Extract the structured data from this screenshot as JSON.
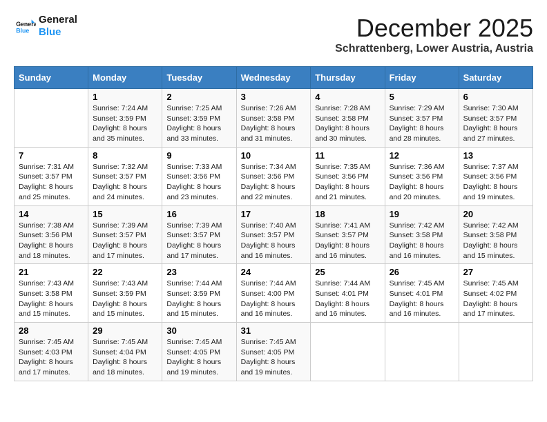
{
  "logo": {
    "line1": "General",
    "line2": "Blue"
  },
  "title": "December 2025",
  "location": "Schrattenberg, Lower Austria, Austria",
  "days_of_week": [
    "Sunday",
    "Monday",
    "Tuesday",
    "Wednesday",
    "Thursday",
    "Friday",
    "Saturday"
  ],
  "weeks": [
    [
      {
        "day": "",
        "info": ""
      },
      {
        "day": "1",
        "info": "Sunrise: 7:24 AM\nSunset: 3:59 PM\nDaylight: 8 hours\nand 35 minutes."
      },
      {
        "day": "2",
        "info": "Sunrise: 7:25 AM\nSunset: 3:59 PM\nDaylight: 8 hours\nand 33 minutes."
      },
      {
        "day": "3",
        "info": "Sunrise: 7:26 AM\nSunset: 3:58 PM\nDaylight: 8 hours\nand 31 minutes."
      },
      {
        "day": "4",
        "info": "Sunrise: 7:28 AM\nSunset: 3:58 PM\nDaylight: 8 hours\nand 30 minutes."
      },
      {
        "day": "5",
        "info": "Sunrise: 7:29 AM\nSunset: 3:57 PM\nDaylight: 8 hours\nand 28 minutes."
      },
      {
        "day": "6",
        "info": "Sunrise: 7:30 AM\nSunset: 3:57 PM\nDaylight: 8 hours\nand 27 minutes."
      }
    ],
    [
      {
        "day": "7",
        "info": "Sunrise: 7:31 AM\nSunset: 3:57 PM\nDaylight: 8 hours\nand 25 minutes."
      },
      {
        "day": "8",
        "info": "Sunrise: 7:32 AM\nSunset: 3:57 PM\nDaylight: 8 hours\nand 24 minutes."
      },
      {
        "day": "9",
        "info": "Sunrise: 7:33 AM\nSunset: 3:56 PM\nDaylight: 8 hours\nand 23 minutes."
      },
      {
        "day": "10",
        "info": "Sunrise: 7:34 AM\nSunset: 3:56 PM\nDaylight: 8 hours\nand 22 minutes."
      },
      {
        "day": "11",
        "info": "Sunrise: 7:35 AM\nSunset: 3:56 PM\nDaylight: 8 hours\nand 21 minutes."
      },
      {
        "day": "12",
        "info": "Sunrise: 7:36 AM\nSunset: 3:56 PM\nDaylight: 8 hours\nand 20 minutes."
      },
      {
        "day": "13",
        "info": "Sunrise: 7:37 AM\nSunset: 3:56 PM\nDaylight: 8 hours\nand 19 minutes."
      }
    ],
    [
      {
        "day": "14",
        "info": "Sunrise: 7:38 AM\nSunset: 3:56 PM\nDaylight: 8 hours\nand 18 minutes."
      },
      {
        "day": "15",
        "info": "Sunrise: 7:39 AM\nSunset: 3:57 PM\nDaylight: 8 hours\nand 17 minutes."
      },
      {
        "day": "16",
        "info": "Sunrise: 7:39 AM\nSunset: 3:57 PM\nDaylight: 8 hours\nand 17 minutes."
      },
      {
        "day": "17",
        "info": "Sunrise: 7:40 AM\nSunset: 3:57 PM\nDaylight: 8 hours\nand 16 minutes."
      },
      {
        "day": "18",
        "info": "Sunrise: 7:41 AM\nSunset: 3:57 PM\nDaylight: 8 hours\nand 16 minutes."
      },
      {
        "day": "19",
        "info": "Sunrise: 7:42 AM\nSunset: 3:58 PM\nDaylight: 8 hours\nand 16 minutes."
      },
      {
        "day": "20",
        "info": "Sunrise: 7:42 AM\nSunset: 3:58 PM\nDaylight: 8 hours\nand 15 minutes."
      }
    ],
    [
      {
        "day": "21",
        "info": "Sunrise: 7:43 AM\nSunset: 3:58 PM\nDaylight: 8 hours\nand 15 minutes."
      },
      {
        "day": "22",
        "info": "Sunrise: 7:43 AM\nSunset: 3:59 PM\nDaylight: 8 hours\nand 15 minutes."
      },
      {
        "day": "23",
        "info": "Sunrise: 7:44 AM\nSunset: 3:59 PM\nDaylight: 8 hours\nand 15 minutes."
      },
      {
        "day": "24",
        "info": "Sunrise: 7:44 AM\nSunset: 4:00 PM\nDaylight: 8 hours\nand 16 minutes."
      },
      {
        "day": "25",
        "info": "Sunrise: 7:44 AM\nSunset: 4:01 PM\nDaylight: 8 hours\nand 16 minutes."
      },
      {
        "day": "26",
        "info": "Sunrise: 7:45 AM\nSunset: 4:01 PM\nDaylight: 8 hours\nand 16 minutes."
      },
      {
        "day": "27",
        "info": "Sunrise: 7:45 AM\nSunset: 4:02 PM\nDaylight: 8 hours\nand 17 minutes."
      }
    ],
    [
      {
        "day": "28",
        "info": "Sunrise: 7:45 AM\nSunset: 4:03 PM\nDaylight: 8 hours\nand 17 minutes."
      },
      {
        "day": "29",
        "info": "Sunrise: 7:45 AM\nSunset: 4:04 PM\nDaylight: 8 hours\nand 18 minutes."
      },
      {
        "day": "30",
        "info": "Sunrise: 7:45 AM\nSunset: 4:05 PM\nDaylight: 8 hours\nand 19 minutes."
      },
      {
        "day": "31",
        "info": "Sunrise: 7:45 AM\nSunset: 4:05 PM\nDaylight: 8 hours\nand 19 minutes."
      },
      {
        "day": "",
        "info": ""
      },
      {
        "day": "",
        "info": ""
      },
      {
        "day": "",
        "info": ""
      }
    ]
  ]
}
